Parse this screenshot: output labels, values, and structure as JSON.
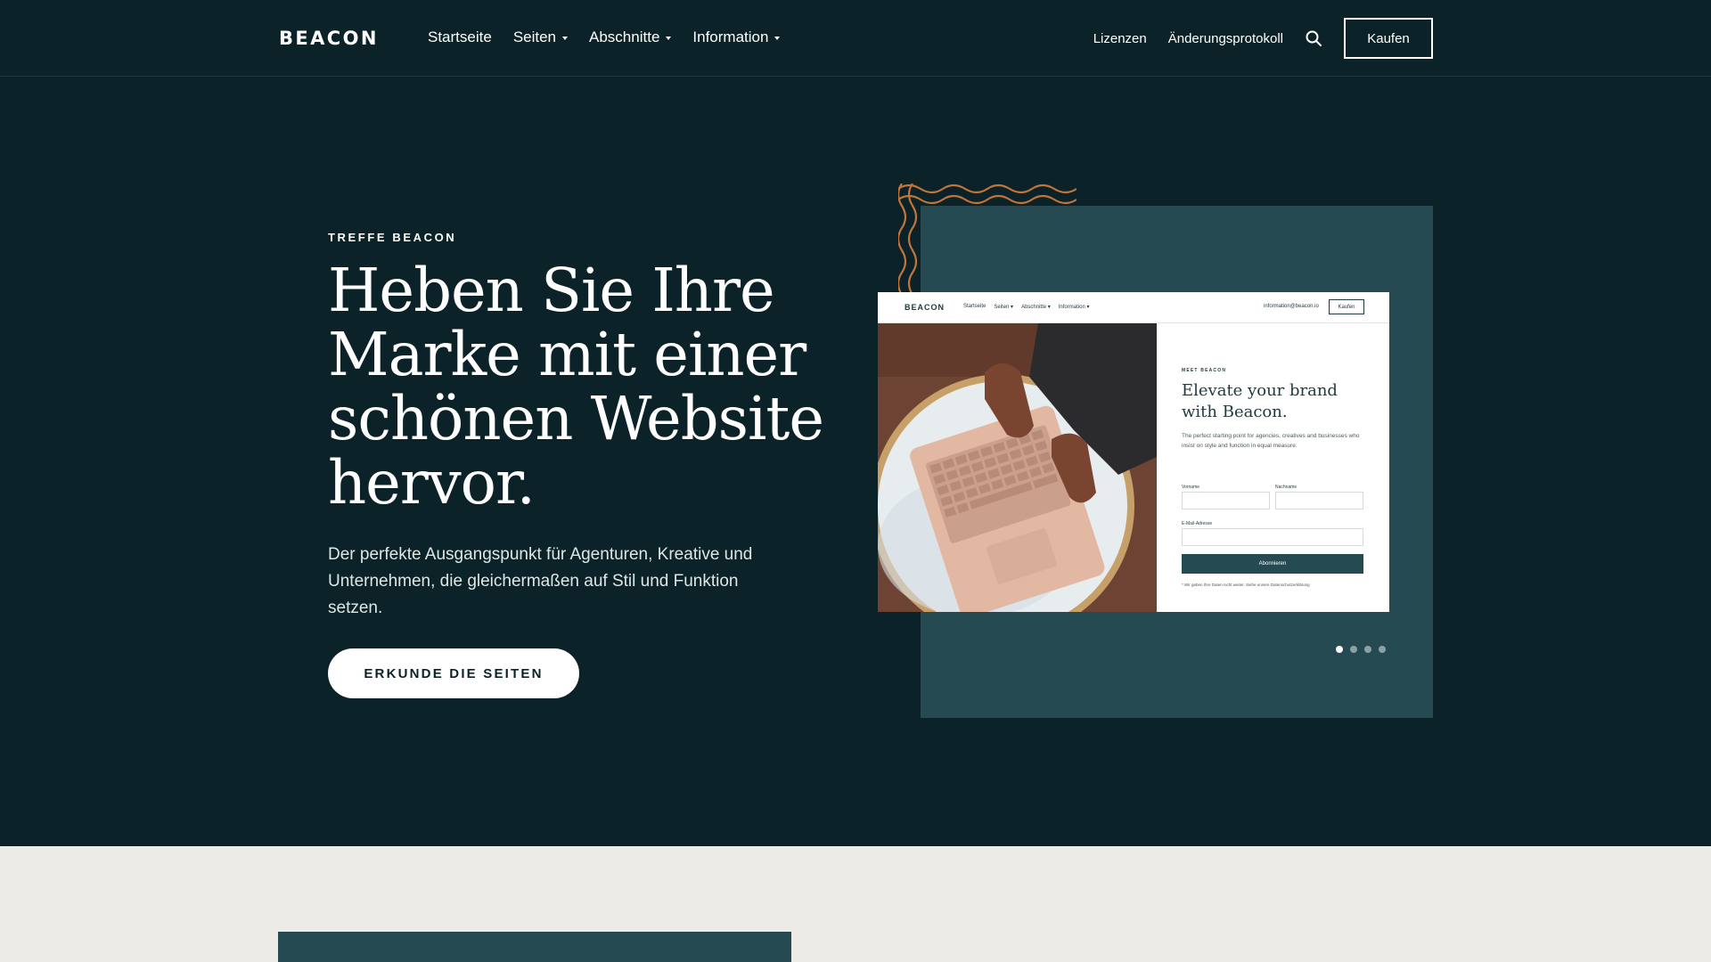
{
  "nav": {
    "logo": "BEACON",
    "menu": [
      {
        "label": "Startseite",
        "dropdown": false
      },
      {
        "label": "Seiten",
        "dropdown": true
      },
      {
        "label": "Abschnitte",
        "dropdown": true
      },
      {
        "label": "Information",
        "dropdown": true
      }
    ],
    "links": [
      "Lizenzen",
      "Änderungsprotokoll"
    ],
    "buy_label": "Kaufen"
  },
  "hero": {
    "eyebrow": "TREFFE BEACON",
    "headline": "Heben Sie Ihre Marke mit einer schönen Website hervor.",
    "subtext": "Der perfekte Ausgangspunkt für Agenturen, Kreative und Unternehmen, die gleichermaßen auf Stil und Funktion setzen.",
    "cta_label": "ERKUNDE DIE SEITEN"
  },
  "preview": {
    "logo": "BEACON",
    "menu": [
      "Startseite",
      "Seiten ▾",
      "Abschnitte ▾",
      "Information ▾"
    ],
    "email": "information@beacon.io",
    "buy_label": "Kaufen",
    "eyebrow": "MEET BEACON",
    "title": "Elevate your brand with Beacon.",
    "description": "The perfect starting point for agencies, creatives and businesses who insist on style and function in equal measure.",
    "first_name_label": "Vorname",
    "last_name_label": "Nachname",
    "email_label": "E-Mail-Adresse",
    "submit_label": "Abonnieren",
    "privacy_text": "* Wir geben Ihre Daten nicht weiter. Siehe unsere Datenschutzerklärung"
  },
  "carousel": {
    "count": 4,
    "active": 1
  },
  "colors": {
    "background": "#0b2328",
    "panel": "#264a51",
    "accent_waves": "#c3743a",
    "lower_background": "#edebe6"
  }
}
